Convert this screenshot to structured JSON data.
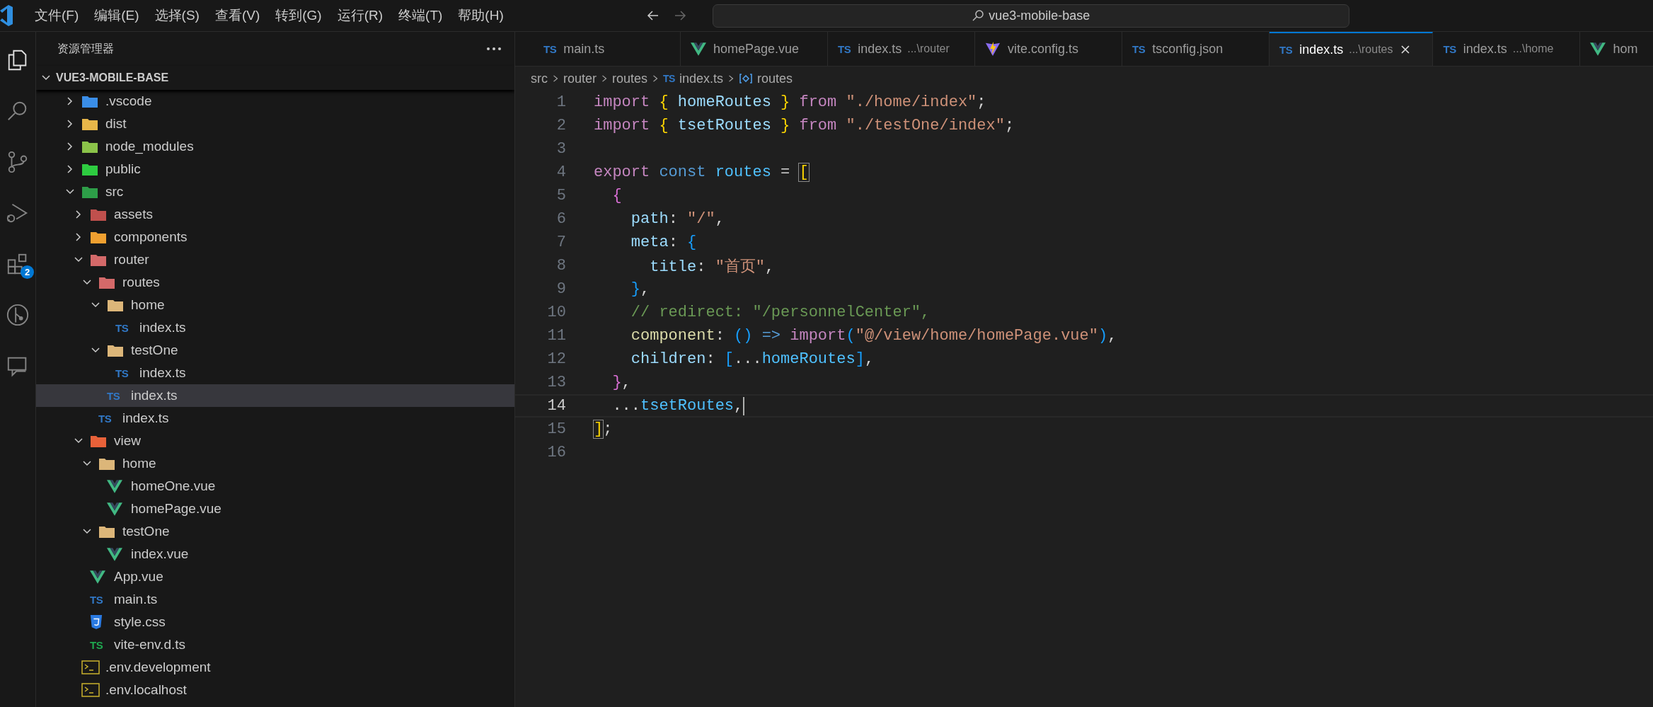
{
  "menu": [
    "文件(F)",
    "编辑(E)",
    "选择(S)",
    "查看(V)",
    "转到(G)",
    "运行(R)",
    "终端(T)",
    "帮助(H)"
  ],
  "command_center": {
    "text": "vue3-mobile-base"
  },
  "activity_bar": [
    {
      "kind": "explorer",
      "selected": true
    },
    {
      "kind": "search",
      "selected": false
    },
    {
      "kind": "scm",
      "selected": false
    },
    {
      "kind": "debug",
      "selected": false
    },
    {
      "kind": "extensions",
      "selected": false,
      "badge": "2"
    },
    {
      "kind": "graph",
      "selected": false
    },
    {
      "kind": "remote",
      "selected": false
    }
  ],
  "explorer": {
    "title": "资源管理器",
    "project": "VUE3-MOBILE-BASE",
    "tree": [
      {
        "label": ".vscode",
        "kind": "vscode",
        "expanded": false,
        "selected": false
      },
      {
        "label": "dist",
        "kind": "dist",
        "expanded": false,
        "selected": false
      },
      {
        "label": "node_modules",
        "kind": "node",
        "expanded": false,
        "selected": false
      },
      {
        "label": "public",
        "kind": "public",
        "expanded": false,
        "selected": false
      },
      {
        "label": "src",
        "kind": "src",
        "expanded": true,
        "selected": false,
        "children": [
          {
            "label": "assets",
            "kind": "assets",
            "expanded": false,
            "selected": false
          },
          {
            "label": "components",
            "kind": "components",
            "expanded": false,
            "selected": false
          },
          {
            "label": "router",
            "kind": "router",
            "expanded": true,
            "selected": false,
            "children": [
              {
                "label": "routes",
                "kind": "router",
                "expanded": true,
                "selected": false,
                "children": [
                  {
                    "label": "home",
                    "kind": "folder",
                    "expanded": true,
                    "selected": false,
                    "children": [
                      {
                        "label": "index.ts",
                        "kind": "ts",
                        "badge": "TS",
                        "selected": false
                      }
                    ]
                  },
                  {
                    "label": "testOne",
                    "kind": "folder",
                    "expanded": true,
                    "selected": false,
                    "children": [
                      {
                        "label": "index.ts",
                        "kind": "ts",
                        "badge": "TS",
                        "selected": false
                      }
                    ]
                  },
                  {
                    "label": "index.ts",
                    "kind": "ts",
                    "badge": "TS",
                    "selected": true
                  }
                ]
              },
              {
                "label": "index.ts",
                "kind": "ts",
                "badge": "TS",
                "selected": false
              }
            ]
          },
          {
            "label": "view",
            "kind": "view",
            "expanded": true,
            "selected": false,
            "children": [
              {
                "label": "home",
                "kind": "folder",
                "expanded": true,
                "selected": false,
                "children": [
                  {
                    "label": "homeOne.vue",
                    "kind": "vue",
                    "selected": false
                  },
                  {
                    "label": "homePage.vue",
                    "kind": "vue",
                    "selected": false
                  }
                ]
              },
              {
                "label": "testOne",
                "kind": "folder",
                "expanded": true,
                "selected": false,
                "children": [
                  {
                    "label": "index.vue",
                    "kind": "vue",
                    "selected": false
                  }
                ]
              }
            ]
          },
          {
            "label": "App.vue",
            "kind": "vue",
            "selected": false
          },
          {
            "label": "main.ts",
            "kind": "ts",
            "badge": "TS",
            "selected": false
          },
          {
            "label": "style.css",
            "kind": "css",
            "selected": false
          },
          {
            "label": "vite-env.d.ts",
            "kind": "dts",
            "badge": "TS",
            "selected": false
          }
        ]
      },
      {
        "label": ".env.development",
        "kind": "env",
        "selected": false
      },
      {
        "label": ".env.localhost",
        "kind": "env",
        "selected": false
      }
    ]
  },
  "tabs": [
    {
      "label": "main.ts",
      "kind": "ts",
      "badge": "TS",
      "selected": false
    },
    {
      "label": "homePage.vue",
      "kind": "vue",
      "selected": false
    },
    {
      "label": "index.ts",
      "description": "...\\router",
      "kind": "ts",
      "badge": "TS",
      "selected": false
    },
    {
      "label": "vite.config.ts",
      "kind": "vite",
      "selected": false
    },
    {
      "label": "tsconfig.json",
      "kind": "tsconfig",
      "badge": "TS",
      "selected": false
    },
    {
      "label": "index.ts",
      "description": "...\\routes",
      "kind": "ts",
      "badge": "TS",
      "selected": true
    },
    {
      "label": "index.ts",
      "description": "...\\home",
      "kind": "ts",
      "badge": "TS",
      "selected": false
    },
    {
      "label": "hom",
      "kind": "vue",
      "selected": false
    }
  ],
  "breadcrumb": [
    {
      "label": "src",
      "kind": "folder"
    },
    {
      "label": "router",
      "kind": "folder"
    },
    {
      "label": "routes",
      "kind": "folder"
    },
    {
      "label": "index.ts",
      "kind": "ts",
      "badge": "TS"
    },
    {
      "label": "routes",
      "kind": "symbol"
    }
  ],
  "code": [
    {
      "number": "1",
      "active": false,
      "tokens": [
        {
          "kind": "kw",
          "text": "import"
        },
        {
          "kind": "b1",
          "text": " {"
        },
        {
          "kind": "var",
          "text": " homeRoutes"
        },
        {
          "kind": "b1",
          "text": " }"
        },
        {
          "kind": "kw",
          "text": " from"
        },
        {
          "kind": "str",
          "text": " \"./home/index\""
        },
        {
          "kind": "p",
          "text": ";"
        }
      ]
    },
    {
      "number": "2",
      "active": false,
      "tokens": [
        {
          "kind": "kw",
          "text": "import"
        },
        {
          "kind": "b1",
          "text": " {"
        },
        {
          "kind": "var",
          "text": " tsetRoutes"
        },
        {
          "kind": "b1",
          "text": " }"
        },
        {
          "kind": "kw",
          "text": " from"
        },
        {
          "kind": "str",
          "text": " \"./testOne/index\""
        },
        {
          "kind": "p",
          "text": ";"
        }
      ]
    },
    {
      "number": "3",
      "active": false
    },
    {
      "number": "4",
      "active": false,
      "tokens": [
        {
          "kind": "kw",
          "text": "export"
        },
        {
          "kind": "st",
          "text": " const"
        },
        {
          "kind": "cvar",
          "text": " routes"
        },
        {
          "kind": "p",
          "text": " = "
        },
        {
          "kind": "match",
          "text": "["
        }
      ]
    },
    {
      "number": "5",
      "active": false,
      "tokens": [
        {
          "kind": "b2",
          "text": "  {"
        }
      ]
    },
    {
      "number": "6",
      "active": false,
      "tokens": [
        {
          "kind": "var",
          "text": "    path"
        },
        {
          "kind": "p",
          "text": ": "
        },
        {
          "kind": "str",
          "text": "\"/\""
        },
        {
          "kind": "p",
          "text": ","
        }
      ]
    },
    {
      "number": "7",
      "active": false,
      "tokens": [
        {
          "kind": "var",
          "text": "    meta"
        },
        {
          "kind": "p",
          "text": ": "
        },
        {
          "kind": "b3",
          "text": "{"
        }
      ]
    },
    {
      "number": "8",
      "active": false,
      "tokens": [
        {
          "kind": "var",
          "text": "      title"
        },
        {
          "kind": "p",
          "text": ": "
        },
        {
          "kind": "str",
          "text": "\"首页\""
        },
        {
          "kind": "p",
          "text": ","
        }
      ]
    },
    {
      "number": "9",
      "active": false,
      "tokens": [
        {
          "kind": "b3",
          "text": "    }"
        },
        {
          "kind": "p",
          "text": ","
        }
      ]
    },
    {
      "number": "10",
      "active": false,
      "tokens": [
        {
          "kind": "com",
          "text": "    // redirect: \"/personnelCenter\","
        }
      ]
    },
    {
      "number": "11",
      "active": false,
      "tokens": [
        {
          "kind": "fn",
          "text": "    component"
        },
        {
          "kind": "p",
          "text": ": "
        },
        {
          "kind": "b3",
          "text": "()"
        },
        {
          "kind": "st",
          "text": " =>"
        },
        {
          "kind": "kw",
          "text": " import"
        },
        {
          "kind": "b3",
          "text": "("
        },
        {
          "kind": "str",
          "text": "\"@/view/home/homePage.vue\""
        },
        {
          "kind": "b3",
          "text": ")"
        },
        {
          "kind": "p",
          "text": ","
        }
      ]
    },
    {
      "number": "12",
      "active": false,
      "tokens": [
        {
          "kind": "var",
          "text": "    children"
        },
        {
          "kind": "p",
          "text": ": "
        },
        {
          "kind": "b3",
          "text": "["
        },
        {
          "kind": "p",
          "text": "..."
        },
        {
          "kind": "cvar",
          "text": "homeRoutes"
        },
        {
          "kind": "b3",
          "text": "]"
        },
        {
          "kind": "p",
          "text": ","
        }
      ]
    },
    {
      "number": "13",
      "active": false,
      "tokens": [
        {
          "kind": "b2",
          "text": "  }"
        },
        {
          "kind": "p",
          "text": ","
        }
      ]
    },
    {
      "number": "14",
      "active": true,
      "tokens": [
        {
          "kind": "p",
          "text": "  ..."
        },
        {
          "kind": "cvar",
          "text": "tsetRoutes"
        },
        {
          "kind": "p",
          "text": ","
        }
      ]
    },
    {
      "number": "15",
      "active": false,
      "tokens": [
        {
          "kind": "match",
          "text": "]"
        },
        {
          "kind": "p",
          "text": ";"
        }
      ]
    },
    {
      "number": "16",
      "active": false
    }
  ]
}
